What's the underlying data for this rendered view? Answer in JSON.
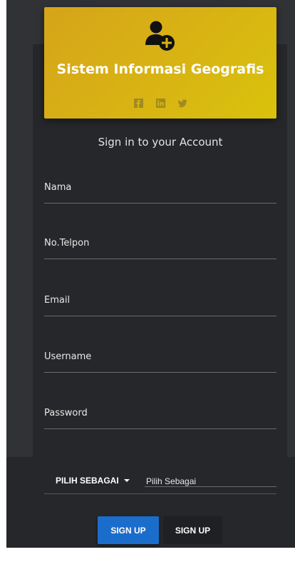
{
  "header": {
    "title": "Sistem Informasi Geografis",
    "icon": "add-user-icon",
    "social_icons": [
      "facebook-icon",
      "linkedin-icon",
      "twitter-icon"
    ]
  },
  "form": {
    "heading": "Sign in to your Account",
    "fields": [
      {
        "label": "Nama"
      },
      {
        "label": "No.Telpon"
      },
      {
        "label": "Email"
      },
      {
        "label": "Username"
      },
      {
        "label": "Password"
      }
    ],
    "role_dropdown_label": "PILIH SEBAGAI",
    "role_value": "Pilih Sebagai",
    "primary_button": "SIGN UP",
    "secondary_button": "SIGN UP"
  },
  "colors": {
    "header_gradient_start": "#d6a41a",
    "header_gradient_end": "#d9c20c",
    "primary_button": "#1b6dcc",
    "panel_background": "#26272a"
  }
}
